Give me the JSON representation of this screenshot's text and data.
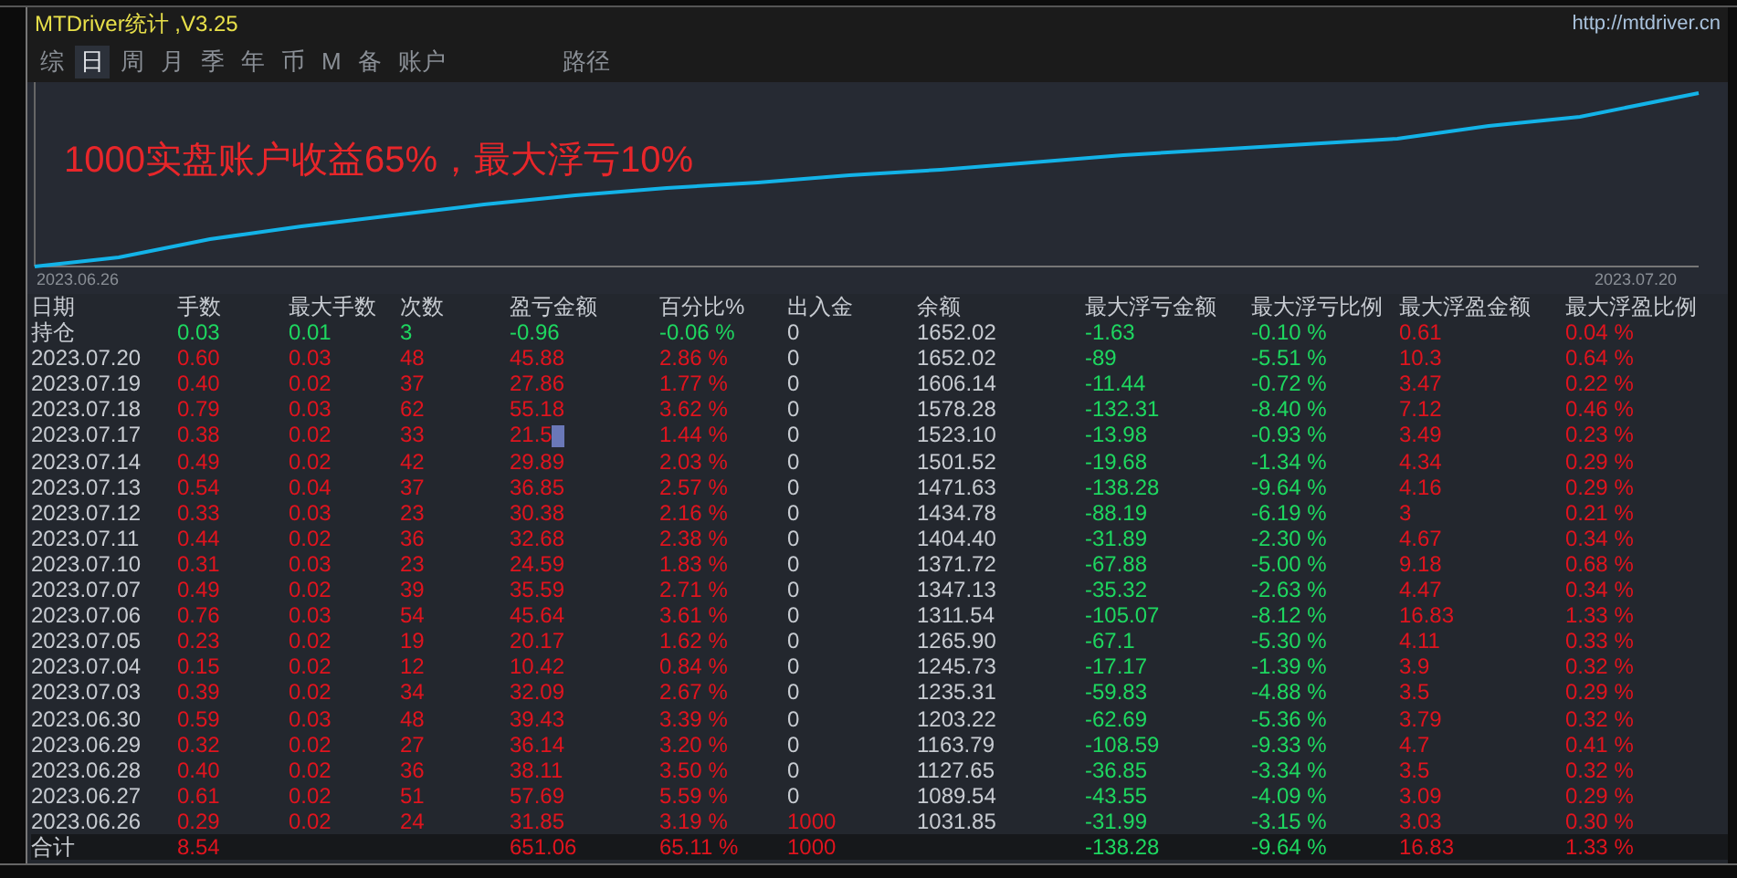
{
  "window": {
    "title": "MTDriver统计 ,V3.25",
    "url": "http://mtdriver.cn"
  },
  "tabs": [
    {
      "label": "综",
      "selected": false
    },
    {
      "label": "日",
      "selected": true
    },
    {
      "label": "周",
      "selected": false
    },
    {
      "label": "月",
      "selected": false
    },
    {
      "label": "季",
      "selected": false
    },
    {
      "label": "年",
      "selected": false
    },
    {
      "label": "币",
      "selected": false
    },
    {
      "label": "M",
      "selected": false
    },
    {
      "label": "备",
      "selected": false
    },
    {
      "label": "账户",
      "selected": false
    },
    {
      "label": "路径",
      "selected": false
    }
  ],
  "chart": {
    "annotation": "1000实盘账户收益65%，最大浮亏10%",
    "start_date": "2023.06.26",
    "end_date": "2023.07.20"
  },
  "table": {
    "columns": [
      "日期",
      "手数",
      "最大手数",
      "次数",
      "盈亏金额",
      "百分比%",
      "出入金",
      "余额",
      "最大浮亏金额",
      "最大浮亏比例",
      "最大浮盈金额",
      "最大浮盈比例"
    ],
    "rows": [
      {
        "kind": "holding",
        "cells": [
          {
            "text": "持仓",
            "kind": "plain"
          },
          {
            "text": "0.03",
            "kind": "loss"
          },
          {
            "text": "0.01",
            "kind": "loss"
          },
          {
            "text": "3",
            "kind": "loss"
          },
          {
            "text": "-0.96",
            "kind": "loss"
          },
          {
            "text": "-0.06 %",
            "kind": "loss"
          },
          {
            "text": "0",
            "kind": "plain"
          },
          {
            "text": "1652.02",
            "kind": "plain"
          },
          {
            "text": "-1.63",
            "kind": "loss"
          },
          {
            "text": "-0.10 %",
            "kind": "loss"
          },
          {
            "text": "0.61",
            "kind": "gain"
          },
          {
            "text": "0.04 %",
            "kind": "gain"
          }
        ]
      },
      {
        "kind": "day",
        "cells": [
          {
            "text": "2023.07.20",
            "kind": "plain"
          },
          {
            "text": "0.60",
            "kind": "gain"
          },
          {
            "text": "0.03",
            "kind": "gain"
          },
          {
            "text": "48",
            "kind": "gain"
          },
          {
            "text": "45.88",
            "kind": "gain"
          },
          {
            "text": "2.86 %",
            "kind": "gain"
          },
          {
            "text": "0",
            "kind": "plain"
          },
          {
            "text": "1652.02",
            "kind": "plain"
          },
          {
            "text": "-89",
            "kind": "loss"
          },
          {
            "text": "-5.51 %",
            "kind": "loss"
          },
          {
            "text": "10.3",
            "kind": "gain"
          },
          {
            "text": "0.64 %",
            "kind": "gain"
          }
        ]
      },
      {
        "kind": "day",
        "cells": [
          {
            "text": "2023.07.19",
            "kind": "plain"
          },
          {
            "text": "0.40",
            "kind": "gain"
          },
          {
            "text": "0.02",
            "kind": "gain"
          },
          {
            "text": "37",
            "kind": "gain"
          },
          {
            "text": "27.86",
            "kind": "gain"
          },
          {
            "text": "1.77 %",
            "kind": "gain"
          },
          {
            "text": "0",
            "kind": "plain"
          },
          {
            "text": "1606.14",
            "kind": "plain"
          },
          {
            "text": "-11.44",
            "kind": "loss"
          },
          {
            "text": "-0.72 %",
            "kind": "loss"
          },
          {
            "text": "3.47",
            "kind": "gain"
          },
          {
            "text": "0.22 %",
            "kind": "gain"
          }
        ]
      },
      {
        "kind": "day",
        "cells": [
          {
            "text": "2023.07.18",
            "kind": "plain"
          },
          {
            "text": "0.79",
            "kind": "gain"
          },
          {
            "text": "0.03",
            "kind": "gain"
          },
          {
            "text": "62",
            "kind": "gain"
          },
          {
            "text": "55.18",
            "kind": "gain"
          },
          {
            "text": "3.62 %",
            "kind": "gain"
          },
          {
            "text": "0",
            "kind": "plain"
          },
          {
            "text": "1578.28",
            "kind": "plain"
          },
          {
            "text": "-132.31",
            "kind": "loss"
          },
          {
            "text": "-8.40 %",
            "kind": "loss"
          },
          {
            "text": "7.12",
            "kind": "gain"
          },
          {
            "text": "0.46 %",
            "kind": "gain"
          }
        ]
      },
      {
        "kind": "day",
        "cells": [
          {
            "text": "2023.07.17",
            "kind": "plain"
          },
          {
            "text": "0.38",
            "kind": "gain"
          },
          {
            "text": "0.02",
            "kind": "gain"
          },
          {
            "text": "33",
            "kind": "gain"
          },
          {
            "text": "21.5",
            "kind": "gain",
            "cursor": true
          },
          {
            "text": "1.44 %",
            "kind": "gain"
          },
          {
            "text": "0",
            "kind": "plain"
          },
          {
            "text": "1523.10",
            "kind": "plain"
          },
          {
            "text": "-13.98",
            "kind": "loss"
          },
          {
            "text": "-0.93 %",
            "kind": "loss"
          },
          {
            "text": "3.49",
            "kind": "gain"
          },
          {
            "text": "0.23 %",
            "kind": "gain"
          }
        ]
      },
      {
        "kind": "day",
        "cells": [
          {
            "text": "2023.07.14",
            "kind": "plain"
          },
          {
            "text": "0.49",
            "kind": "gain"
          },
          {
            "text": "0.02",
            "kind": "gain"
          },
          {
            "text": "42",
            "kind": "gain"
          },
          {
            "text": "29.89",
            "kind": "gain"
          },
          {
            "text": "2.03 %",
            "kind": "gain"
          },
          {
            "text": "0",
            "kind": "plain"
          },
          {
            "text": "1501.52",
            "kind": "plain"
          },
          {
            "text": "-19.68",
            "kind": "loss"
          },
          {
            "text": "-1.34 %",
            "kind": "loss"
          },
          {
            "text": "4.34",
            "kind": "gain"
          },
          {
            "text": "0.29 %",
            "kind": "gain"
          }
        ]
      },
      {
        "kind": "day",
        "cells": [
          {
            "text": "2023.07.13",
            "kind": "plain"
          },
          {
            "text": "0.54",
            "kind": "gain"
          },
          {
            "text": "0.04",
            "kind": "gain"
          },
          {
            "text": "37",
            "kind": "gain"
          },
          {
            "text": "36.85",
            "kind": "gain"
          },
          {
            "text": "2.57 %",
            "kind": "gain"
          },
          {
            "text": "0",
            "kind": "plain"
          },
          {
            "text": "1471.63",
            "kind": "plain"
          },
          {
            "text": "-138.28",
            "kind": "loss"
          },
          {
            "text": "-9.64 %",
            "kind": "loss"
          },
          {
            "text": "4.16",
            "kind": "gain"
          },
          {
            "text": "0.29 %",
            "kind": "gain"
          }
        ]
      },
      {
        "kind": "day",
        "cells": [
          {
            "text": "2023.07.12",
            "kind": "plain"
          },
          {
            "text": "0.33",
            "kind": "gain"
          },
          {
            "text": "0.03",
            "kind": "gain"
          },
          {
            "text": "23",
            "kind": "gain"
          },
          {
            "text": "30.38",
            "kind": "gain"
          },
          {
            "text": "2.16 %",
            "kind": "gain"
          },
          {
            "text": "0",
            "kind": "plain"
          },
          {
            "text": "1434.78",
            "kind": "plain"
          },
          {
            "text": "-88.19",
            "kind": "loss"
          },
          {
            "text": "-6.19 %",
            "kind": "loss"
          },
          {
            "text": "3",
            "kind": "gain"
          },
          {
            "text": "0.21 %",
            "kind": "gain"
          }
        ]
      },
      {
        "kind": "day",
        "cells": [
          {
            "text": "2023.07.11",
            "kind": "plain"
          },
          {
            "text": "0.44",
            "kind": "gain"
          },
          {
            "text": "0.02",
            "kind": "gain"
          },
          {
            "text": "36",
            "kind": "gain"
          },
          {
            "text": "32.68",
            "kind": "gain"
          },
          {
            "text": "2.38 %",
            "kind": "gain"
          },
          {
            "text": "0",
            "kind": "plain"
          },
          {
            "text": "1404.40",
            "kind": "plain"
          },
          {
            "text": "-31.89",
            "kind": "loss"
          },
          {
            "text": "-2.30 %",
            "kind": "loss"
          },
          {
            "text": "4.67",
            "kind": "gain"
          },
          {
            "text": "0.34 %",
            "kind": "gain"
          }
        ]
      },
      {
        "kind": "day",
        "cells": [
          {
            "text": "2023.07.10",
            "kind": "plain"
          },
          {
            "text": "0.31",
            "kind": "gain"
          },
          {
            "text": "0.03",
            "kind": "gain"
          },
          {
            "text": "23",
            "kind": "gain"
          },
          {
            "text": "24.59",
            "kind": "gain"
          },
          {
            "text": "1.83 %",
            "kind": "gain"
          },
          {
            "text": "0",
            "kind": "plain"
          },
          {
            "text": "1371.72",
            "kind": "plain"
          },
          {
            "text": "-67.88",
            "kind": "loss"
          },
          {
            "text": "-5.00 %",
            "kind": "loss"
          },
          {
            "text": "9.18",
            "kind": "gain"
          },
          {
            "text": "0.68 %",
            "kind": "gain"
          }
        ]
      },
      {
        "kind": "day",
        "cells": [
          {
            "text": "2023.07.07",
            "kind": "plain"
          },
          {
            "text": "0.49",
            "kind": "gain"
          },
          {
            "text": "0.02",
            "kind": "gain"
          },
          {
            "text": "39",
            "kind": "gain"
          },
          {
            "text": "35.59",
            "kind": "gain"
          },
          {
            "text": "2.71 %",
            "kind": "gain"
          },
          {
            "text": "0",
            "kind": "plain"
          },
          {
            "text": "1347.13",
            "kind": "plain"
          },
          {
            "text": "-35.32",
            "kind": "loss"
          },
          {
            "text": "-2.63 %",
            "kind": "loss"
          },
          {
            "text": "4.47",
            "kind": "gain"
          },
          {
            "text": "0.34 %",
            "kind": "gain"
          }
        ]
      },
      {
        "kind": "day",
        "cells": [
          {
            "text": "2023.07.06",
            "kind": "plain"
          },
          {
            "text": "0.76",
            "kind": "gain"
          },
          {
            "text": "0.03",
            "kind": "gain"
          },
          {
            "text": "54",
            "kind": "gain"
          },
          {
            "text": "45.64",
            "kind": "gain"
          },
          {
            "text": "3.61 %",
            "kind": "gain"
          },
          {
            "text": "0",
            "kind": "plain"
          },
          {
            "text": "1311.54",
            "kind": "plain"
          },
          {
            "text": "-105.07",
            "kind": "loss"
          },
          {
            "text": "-8.12 %",
            "kind": "loss"
          },
          {
            "text": "16.83",
            "kind": "gain"
          },
          {
            "text": "1.33 %",
            "kind": "gain"
          }
        ]
      },
      {
        "kind": "day",
        "cells": [
          {
            "text": "2023.07.05",
            "kind": "plain"
          },
          {
            "text": "0.23",
            "kind": "gain"
          },
          {
            "text": "0.02",
            "kind": "gain"
          },
          {
            "text": "19",
            "kind": "gain"
          },
          {
            "text": "20.17",
            "kind": "gain"
          },
          {
            "text": "1.62 %",
            "kind": "gain"
          },
          {
            "text": "0",
            "kind": "plain"
          },
          {
            "text": "1265.90",
            "kind": "plain"
          },
          {
            "text": "-67.1",
            "kind": "loss"
          },
          {
            "text": "-5.30 %",
            "kind": "loss"
          },
          {
            "text": "4.11",
            "kind": "gain"
          },
          {
            "text": "0.33 %",
            "kind": "gain"
          }
        ]
      },
      {
        "kind": "day",
        "cells": [
          {
            "text": "2023.07.04",
            "kind": "plain"
          },
          {
            "text": "0.15",
            "kind": "gain"
          },
          {
            "text": "0.02",
            "kind": "gain"
          },
          {
            "text": "12",
            "kind": "gain"
          },
          {
            "text": "10.42",
            "kind": "gain"
          },
          {
            "text": "0.84 %",
            "kind": "gain"
          },
          {
            "text": "0",
            "kind": "plain"
          },
          {
            "text": "1245.73",
            "kind": "plain"
          },
          {
            "text": "-17.17",
            "kind": "loss"
          },
          {
            "text": "-1.39 %",
            "kind": "loss"
          },
          {
            "text": "3.9",
            "kind": "gain"
          },
          {
            "text": "0.32 %",
            "kind": "gain"
          }
        ]
      },
      {
        "kind": "day",
        "cells": [
          {
            "text": "2023.07.03",
            "kind": "plain"
          },
          {
            "text": "0.39",
            "kind": "gain"
          },
          {
            "text": "0.02",
            "kind": "gain"
          },
          {
            "text": "34",
            "kind": "gain"
          },
          {
            "text": "32.09",
            "kind": "gain"
          },
          {
            "text": "2.67 %",
            "kind": "gain"
          },
          {
            "text": "0",
            "kind": "plain"
          },
          {
            "text": "1235.31",
            "kind": "plain"
          },
          {
            "text": "-59.83",
            "kind": "loss"
          },
          {
            "text": "-4.88 %",
            "kind": "loss"
          },
          {
            "text": "3.5",
            "kind": "gain"
          },
          {
            "text": "0.29 %",
            "kind": "gain"
          }
        ]
      },
      {
        "kind": "day",
        "cells": [
          {
            "text": "2023.06.30",
            "kind": "plain"
          },
          {
            "text": "0.59",
            "kind": "gain"
          },
          {
            "text": "0.03",
            "kind": "gain"
          },
          {
            "text": "48",
            "kind": "gain"
          },
          {
            "text": "39.43",
            "kind": "gain"
          },
          {
            "text": "3.39 %",
            "kind": "gain"
          },
          {
            "text": "0",
            "kind": "plain"
          },
          {
            "text": "1203.22",
            "kind": "plain"
          },
          {
            "text": "-62.69",
            "kind": "loss"
          },
          {
            "text": "-5.36 %",
            "kind": "loss"
          },
          {
            "text": "3.79",
            "kind": "gain"
          },
          {
            "text": "0.32 %",
            "kind": "gain"
          }
        ]
      },
      {
        "kind": "day",
        "cells": [
          {
            "text": "2023.06.29",
            "kind": "plain"
          },
          {
            "text": "0.32",
            "kind": "gain"
          },
          {
            "text": "0.02",
            "kind": "gain"
          },
          {
            "text": "27",
            "kind": "gain"
          },
          {
            "text": "36.14",
            "kind": "gain"
          },
          {
            "text": "3.20 %",
            "kind": "gain"
          },
          {
            "text": "0",
            "kind": "plain"
          },
          {
            "text": "1163.79",
            "kind": "plain"
          },
          {
            "text": "-108.59",
            "kind": "loss"
          },
          {
            "text": "-9.33 %",
            "kind": "loss"
          },
          {
            "text": "4.7",
            "kind": "gain"
          },
          {
            "text": "0.41 %",
            "kind": "gain"
          }
        ]
      },
      {
        "kind": "day",
        "cells": [
          {
            "text": "2023.06.28",
            "kind": "plain"
          },
          {
            "text": "0.40",
            "kind": "gain"
          },
          {
            "text": "0.02",
            "kind": "gain"
          },
          {
            "text": "36",
            "kind": "gain"
          },
          {
            "text": "38.11",
            "kind": "gain"
          },
          {
            "text": "3.50 %",
            "kind": "gain"
          },
          {
            "text": "0",
            "kind": "plain"
          },
          {
            "text": "1127.65",
            "kind": "plain"
          },
          {
            "text": "-36.85",
            "kind": "loss"
          },
          {
            "text": "-3.34 %",
            "kind": "loss"
          },
          {
            "text": "3.5",
            "kind": "gain"
          },
          {
            "text": "0.32 %",
            "kind": "gain"
          }
        ]
      },
      {
        "kind": "day",
        "cells": [
          {
            "text": "2023.06.27",
            "kind": "plain"
          },
          {
            "text": "0.61",
            "kind": "gain"
          },
          {
            "text": "0.02",
            "kind": "gain"
          },
          {
            "text": "51",
            "kind": "gain"
          },
          {
            "text": "57.69",
            "kind": "gain"
          },
          {
            "text": "5.59 %",
            "kind": "gain"
          },
          {
            "text": "0",
            "kind": "plain"
          },
          {
            "text": "1089.54",
            "kind": "plain"
          },
          {
            "text": "-43.55",
            "kind": "loss"
          },
          {
            "text": "-4.09 %",
            "kind": "loss"
          },
          {
            "text": "3.09",
            "kind": "gain"
          },
          {
            "text": "0.29 %",
            "kind": "gain"
          }
        ]
      },
      {
        "kind": "day",
        "cells": [
          {
            "text": "2023.06.26",
            "kind": "plain"
          },
          {
            "text": "0.29",
            "kind": "gain"
          },
          {
            "text": "0.02",
            "kind": "gain"
          },
          {
            "text": "24",
            "kind": "gain"
          },
          {
            "text": "31.85",
            "kind": "gain"
          },
          {
            "text": "3.19 %",
            "kind": "gain"
          },
          {
            "text": "1000",
            "kind": "gain"
          },
          {
            "text": "1031.85",
            "kind": "plain"
          },
          {
            "text": "-31.99",
            "kind": "loss"
          },
          {
            "text": "-3.15 %",
            "kind": "loss"
          },
          {
            "text": "3.03",
            "kind": "gain"
          },
          {
            "text": "0.30 %",
            "kind": "gain"
          }
        ]
      },
      {
        "kind": "total",
        "cells": [
          {
            "text": "合计",
            "kind": "plain"
          },
          {
            "text": "8.54",
            "kind": "gain"
          },
          null,
          null,
          {
            "text": "651.06",
            "kind": "gain"
          },
          {
            "text": "65.11 %",
            "kind": "gain"
          },
          {
            "text": "1000",
            "kind": "gain"
          },
          null,
          {
            "text": "-138.28",
            "kind": "loss"
          },
          {
            "text": "-9.64 %",
            "kind": "loss"
          },
          {
            "text": "16.83",
            "kind": "gain"
          },
          {
            "text": "1.33 %",
            "kind": "gain"
          }
        ]
      }
    ]
  }
}
